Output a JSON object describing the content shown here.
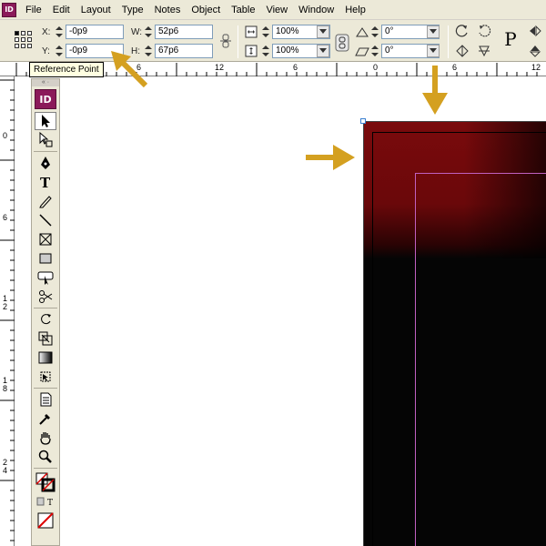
{
  "app": {
    "icon_label": "ID",
    "toolbox_logo": "ID"
  },
  "menu": [
    "File",
    "Edit",
    "Layout",
    "Type",
    "Notes",
    "Object",
    "Table",
    "View",
    "Window",
    "Help"
  ],
  "control_panel": {
    "x_label": "X:",
    "x_value": "-0p9",
    "y_label": "Y:",
    "y_value": "-0p9",
    "w_label": "W:",
    "w_value": "52p6",
    "h_label": "H:",
    "h_value": "67p6",
    "scale_x_value": "100%",
    "scale_y_value": "100%",
    "rotate_value": "0°",
    "shear_value": "0°",
    "type_icon": "P"
  },
  "tooltip": "Reference Point",
  "ruler_top": {
    "labels": [
      "6",
      "12",
      "6",
      "0",
      "6",
      "12",
      "6"
    ]
  },
  "ruler_left": {
    "labels": [
      "0",
      "6",
      "1\n2",
      "1\n8",
      "2\n4"
    ]
  },
  "toolbox": {
    "tools": [
      "selection-tool",
      "direct-selection-tool",
      "pen-tool",
      "type-tool",
      "pencil-tool",
      "line-tool",
      "rectangle-frame-tool",
      "rectangle-tool",
      "button-tool",
      "scissors-tool",
      "rotate-tool",
      "scale-tool",
      "gradient-tool",
      "free-transform-tool",
      "note-tool",
      "eyedropper-tool",
      "hand-tool",
      "zoom-tool",
      "fill-stroke-swatch",
      "apply-color",
      "none-swatch"
    ]
  },
  "annotations": {
    "arrow_color": "#d4a020"
  },
  "colors": {
    "page_red": "#7a0a0c",
    "margin_guide": "#c060c0",
    "ui_bg": "#ece9d8"
  }
}
